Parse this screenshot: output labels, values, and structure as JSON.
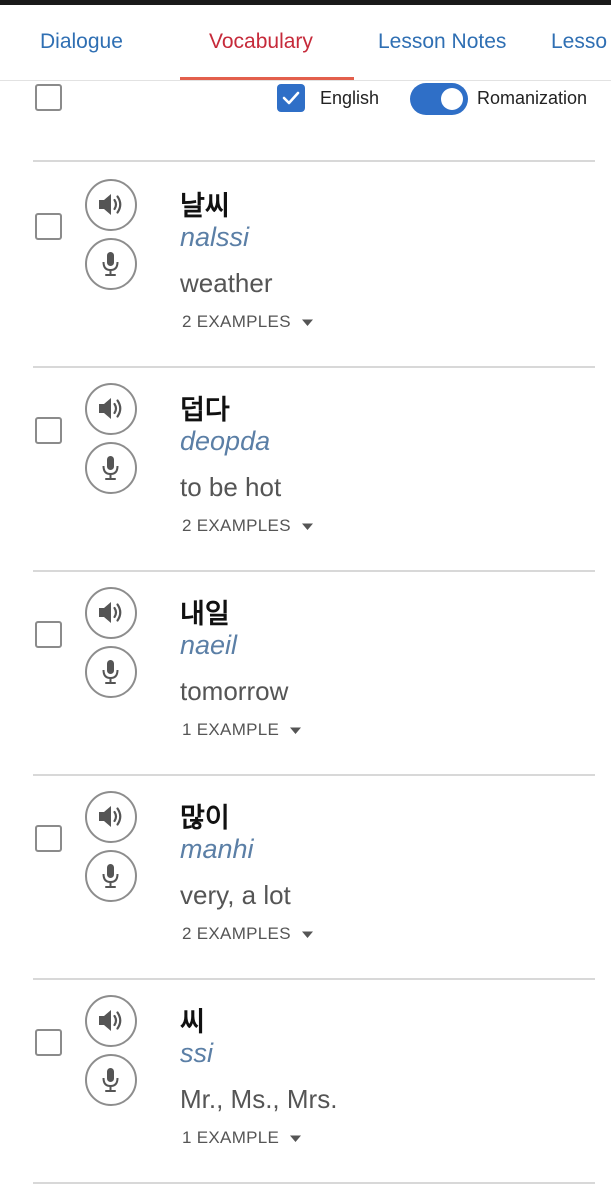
{
  "tabs": [
    {
      "label": "Dialogue"
    },
    {
      "label": "Vocabulary"
    },
    {
      "label": "Lesson Notes"
    },
    {
      "label": "Lesso"
    }
  ],
  "active_tab": "Vocabulary",
  "colors": {
    "tab_text": "#2f6fb3",
    "active_tab_text": "#c62a3a",
    "active_tab_underline": "#e35f4c",
    "toggle_on": "#2f6fc7",
    "romanization_text": "#5b7fa6"
  },
  "toolbar": {
    "english_label": "English",
    "english_checked": true,
    "romanization_label": "Romanization",
    "romanization_on": true
  },
  "vocab": [
    {
      "korean": "날씨",
      "romanization": "nalssi",
      "english": "weather",
      "examples": "2 EXAMPLES"
    },
    {
      "korean": "덥다",
      "romanization": "deopda",
      "english": "to be hot",
      "examples": "2 EXAMPLES"
    },
    {
      "korean": "내일",
      "romanization": "naeil",
      "english": "tomorrow",
      "examples": "1 EXAMPLE"
    },
    {
      "korean": "많이",
      "romanization": "manhi",
      "english": "very, a lot",
      "examples": "2 EXAMPLES"
    },
    {
      "korean": "씨",
      "romanization": "ssi",
      "english": "Mr., Ms., Mrs.",
      "examples": "1 EXAMPLE"
    }
  ],
  "icons": {
    "speaker": "speaker-icon",
    "mic": "microphone-icon",
    "caret": "caret-down-icon",
    "check": "checkmark-icon"
  }
}
